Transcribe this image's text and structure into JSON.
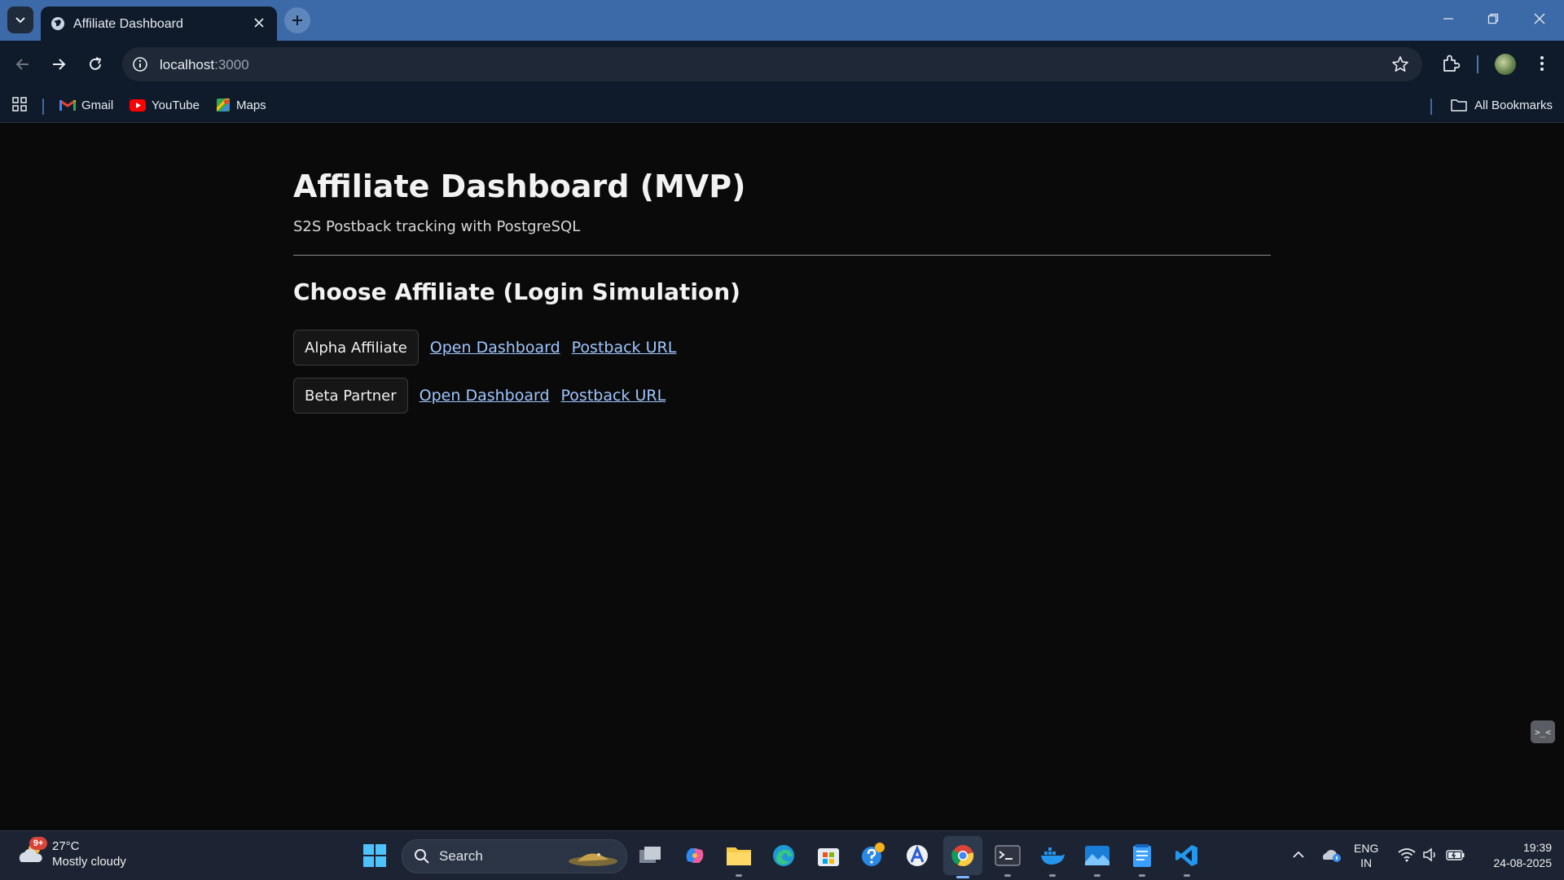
{
  "browser": {
    "tab_title": "Affiliate Dashboard",
    "url_host": "localhost",
    "url_port": ":3000"
  },
  "bookmarks": {
    "items": [
      {
        "label": "Gmail",
        "icon": "gmail-icon"
      },
      {
        "label": "YouTube",
        "icon": "youtube-icon"
      },
      {
        "label": "Maps",
        "icon": "maps-icon"
      }
    ],
    "all_label": "All Bookmarks"
  },
  "page": {
    "title": "Affiliate Dashboard (MVP)",
    "subtitle": "S2S Postback tracking with PostgreSQL",
    "section_title": "Choose Affiliate (Login Simulation)",
    "affiliates": [
      {
        "name": "Alpha Affiliate",
        "dashboard_link": "Open Dashboard",
        "postback_link": "Postback URL"
      },
      {
        "name": "Beta Partner",
        "dashboard_link": "Open Dashboard",
        "postback_link": "Postback URL"
      }
    ],
    "link_color": "#9ec5ff",
    "background_color": "#0a0a0a"
  },
  "taskbar": {
    "weather_badge": "9+",
    "weather_temp": "27°C",
    "weather_desc": "Mostly cloudy",
    "search_label": "Search",
    "lang_line1": "ENG",
    "lang_line2": "IN",
    "time": "19:39",
    "date": "24-08-2025"
  },
  "theme": {
    "titlebar_color": "#3c6aa8",
    "toolbar_color": "#0f1a2a",
    "taskbar_color": "#1c2433"
  }
}
